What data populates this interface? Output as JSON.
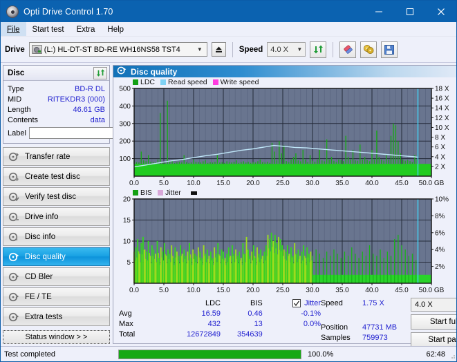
{
  "window": {
    "title": "Opti Drive Control 1.70",
    "icon": "disc-icon",
    "minimize": "minimize-icon",
    "maximize": "maximize-icon",
    "close": "close-icon"
  },
  "menubar": {
    "items": [
      {
        "label": "File",
        "active": true
      },
      {
        "label": "Start test",
        "active": false
      },
      {
        "label": "Extra",
        "active": false
      },
      {
        "label": "Help",
        "active": false
      }
    ]
  },
  "toolbar": {
    "drive_label": "Drive",
    "drive_value": "(L:)  HL-DT-ST BD-RE  WH16NS58 TST4",
    "eject_icon": "eject-icon",
    "speed_label": "Speed",
    "speed_value": "4.0 X",
    "refresh_icon": "refresh-icon",
    "eraser_icon": "eraser-icon",
    "discs_icon": "gold-discs-icon",
    "save_icon": "save-floppy-icon"
  },
  "disc_panel": {
    "title": "Disc",
    "refresh_icon": "refresh-icon",
    "rows": [
      {
        "key": "Type",
        "value": "BD-R DL"
      },
      {
        "key": "MID",
        "value": "RITEKDR3 (000)"
      },
      {
        "key": "Length",
        "value": "46.61 GB"
      },
      {
        "key": "Contents",
        "value": "data"
      }
    ],
    "label_key": "Label",
    "label_value": "",
    "label_placeholder": "",
    "label_button_icon": "disc-label-icon"
  },
  "sidebar": {
    "items": [
      {
        "label": "Transfer rate",
        "selected": false
      },
      {
        "label": "Create test disc",
        "selected": false
      },
      {
        "label": "Verify test disc",
        "selected": false
      },
      {
        "label": "Drive info",
        "selected": false
      },
      {
        "label": "Disc info",
        "selected": false
      },
      {
        "label": "Disc quality",
        "selected": true
      },
      {
        "label": "CD Bler",
        "selected": false
      },
      {
        "label": "FE / TE",
        "selected": false
      },
      {
        "label": "Extra tests",
        "selected": false
      }
    ],
    "status_window_label": "Status window > >"
  },
  "main": {
    "header_title": "Disc quality",
    "header_icon": "disc-quality-icon"
  },
  "chart_data": [
    {
      "type": "line",
      "name": "ldc-read-speed-chart",
      "title": "",
      "xlabel": "GB",
      "ylabel": "",
      "legend": [
        {
          "label": "LDC",
          "color": "#13a013"
        },
        {
          "label": "Read speed",
          "color": "#7fd2f4"
        },
        {
          "label": "Write speed",
          "color": "#ff3ce0"
        }
      ],
      "legend_position": "top-left",
      "grid": true,
      "x_ticks": [
        "0.0",
        "5.0",
        "10.0",
        "15.0",
        "20.0",
        "25.0",
        "30.0",
        "35.0",
        "40.0",
        "45.0",
        "50.0 GB"
      ],
      "xlim": [
        0,
        50
      ],
      "y_left_ticks": [
        "100",
        "200",
        "300",
        "400",
        "500"
      ],
      "ylim": [
        0,
        500
      ],
      "y_right_ticks": [
        "2 X",
        "4 X",
        "6 X",
        "8 X",
        "10 X",
        "12 X",
        "14 X",
        "16 X",
        "18 X"
      ],
      "ylim_right": [
        0,
        18
      ],
      "cursor_x": 47.73,
      "series": [
        {
          "name": "LDC",
          "color": "#13a013",
          "baseline": 70,
          "x": [
            0.0,
            0.4,
            0.8,
            1.2,
            1.6,
            2.0,
            2.4,
            2.8,
            3.2,
            3.6,
            4.0,
            4.4,
            4.8,
            5.2,
            5.6,
            6.0,
            6.4,
            6.8,
            7.2,
            7.6,
            8.0,
            8.4,
            8.8,
            9.2,
            9.6,
            10.0,
            10.4,
            10.8,
            11.2,
            11.6,
            12.0,
            12.4,
            12.8,
            13.2,
            13.6,
            14.0,
            14.4,
            14.8,
            15.2,
            15.6,
            16.0,
            16.4,
            16.8,
            17.2,
            17.6,
            18.0,
            18.4,
            18.8,
            19.2,
            19.6,
            20.0,
            20.4,
            20.8,
            21.2,
            21.6,
            22.0,
            22.4,
            22.8,
            23.2,
            23.6,
            24.0,
            24.4,
            24.8,
            25.2,
            25.6,
            26.0,
            26.4,
            26.8,
            27.2,
            27.6,
            28.0,
            28.4,
            28.8,
            29.2,
            29.6,
            30.0,
            30.4,
            30.8,
            31.2,
            31.6,
            32.0,
            32.4,
            32.8,
            33.2,
            33.6,
            34.0,
            34.4,
            34.8,
            35.2,
            35.6,
            36.0,
            36.4,
            36.8,
            37.2,
            37.6,
            38.0,
            38.4,
            38.8,
            39.2,
            39.6,
            40.0,
            40.4,
            40.8,
            41.2,
            41.6,
            42.0,
            42.4,
            42.8,
            43.2,
            43.6,
            44.0,
            44.4,
            44.8,
            45.2,
            45.6,
            46.0,
            46.4,
            46.8,
            47.2,
            47.6
          ],
          "values": [
            95,
            80,
            78,
            140,
            90,
            85,
            120,
            82,
            80,
            78,
            95,
            360,
            80,
            76,
            430,
            85,
            90,
            75,
            80,
            82,
            78,
            120,
            80,
            76,
            78,
            95,
            82,
            80,
            78,
            85,
            90,
            76,
            80,
            78,
            82,
            120,
            78,
            80,
            76,
            85,
            80,
            78,
            82,
            90,
            76,
            80,
            85,
            78,
            82,
            76,
            80,
            78,
            85,
            95,
            80,
            78,
            82,
            76,
            190,
            140,
            90,
            200,
            130,
            175,
            86,
            80,
            95,
            110,
            130,
            90,
            85,
            150,
            95,
            80,
            120,
            88,
            82,
            95,
            150,
            90,
            85,
            210,
            95,
            110,
            88,
            80,
            95,
            92,
            86,
            230,
            110,
            95,
            150,
            90,
            88,
            180,
            95,
            110,
            92,
            85,
            150,
            95,
            260,
            110,
            95,
            88,
            120,
            95,
            230,
            300,
            290,
            200,
            130,
            95,
            88,
            92,
            86,
            80,
            120,
            95
          ]
        },
        {
          "name": "Read speed",
          "color": "#a9dcf4",
          "x": [
            0.0,
            2.0,
            4.0,
            6.0,
            8.0,
            10.0,
            12.0,
            14.0,
            16.0,
            18.0,
            20.0,
            22.0,
            23.5,
            24.5,
            25.5,
            27.0,
            29.0,
            31.0,
            33.0,
            35.0,
            37.0,
            39.0,
            41.0,
            43.0,
            45.0,
            47.0,
            47.7
          ],
          "values": [
            1.9,
            2.3,
            2.7,
            3.1,
            3.4,
            3.8,
            4.2,
            4.5,
            4.9,
            5.3,
            5.6,
            6.0,
            6.3,
            6.2,
            6.1,
            5.9,
            5.8,
            5.6,
            5.4,
            5.2,
            5.0,
            4.8,
            4.6,
            4.4,
            4.2,
            4.0,
            3.9
          ]
        }
      ]
    },
    {
      "type": "bar",
      "name": "bis-jitter-chart",
      "title": "",
      "xlabel": "GB",
      "ylabel": "",
      "legend": [
        {
          "label": "BIS",
          "color": "#13a013"
        },
        {
          "label": "Jitter",
          "color": "#d9a8d9"
        }
      ],
      "legend_position": "top-left",
      "grid": true,
      "x_ticks": [
        "0.0",
        "5.0",
        "10.0",
        "15.0",
        "20.0",
        "25.0",
        "30.0",
        "35.0",
        "40.0",
        "45.0",
        "50.0 GB"
      ],
      "xlim": [
        0,
        50
      ],
      "y_left_ticks": [
        "5",
        "10",
        "15",
        "20"
      ],
      "ylim": [
        0,
        20
      ],
      "y_right_ticks": [
        "2%",
        "4%",
        "6%",
        "8%",
        "10%"
      ],
      "ylim_right": [
        0,
        10
      ],
      "cursor_x": 47.73,
      "series": [
        {
          "name": "BIS",
          "color": "#13a013",
          "baseline": 2.0,
          "x": [
            0.0,
            0.3,
            0.6,
            0.9,
            1.2,
            1.5,
            1.8,
            2.1,
            2.4,
            2.7,
            3.0,
            3.3,
            3.6,
            3.9,
            4.2,
            4.5,
            4.8,
            5.1,
            5.4,
            5.7,
            6.0,
            6.3,
            6.6,
            6.9,
            7.2,
            7.5,
            7.8,
            8.1,
            8.4,
            8.7,
            9.0,
            9.3,
            9.6,
            9.9,
            10.2,
            10.5,
            10.8,
            11.1,
            11.4,
            11.7,
            12.0,
            12.3,
            12.6,
            12.9,
            13.2,
            13.5,
            13.8,
            14.1,
            14.4,
            14.7,
            15.0,
            15.3,
            15.6,
            15.9,
            16.2,
            16.5,
            16.8,
            17.1,
            17.4,
            17.7,
            18.0,
            18.3,
            18.6,
            18.9,
            19.2,
            19.5,
            19.8,
            20.1,
            20.4,
            20.7,
            21.0,
            21.3,
            21.6,
            21.9,
            22.2,
            22.5,
            22.8,
            23.1,
            23.4,
            23.7,
            24.0,
            24.3,
            24.6,
            24.9,
            25.2,
            25.5,
            25.8,
            26.1,
            26.4,
            26.7,
            27.0,
            27.3,
            27.6,
            27.9,
            28.2,
            28.5,
            28.8,
            29.1,
            29.4,
            29.7,
            30.0,
            30.6,
            31.2,
            31.8,
            32.4,
            33.0,
            33.6,
            34.2,
            34.8,
            35.4,
            36.0,
            36.6,
            37.2,
            37.8,
            38.4,
            39.0,
            39.6,
            40.2,
            40.8,
            41.4,
            42.0,
            42.6,
            43.2,
            43.8,
            44.4,
            45.0,
            45.6,
            46.2,
            46.8,
            47.4
          ],
          "values": [
            7.5,
            8.5,
            10.5,
            7.0,
            9.5,
            11.0,
            8.0,
            7.5,
            10.0,
            6.5,
            9.0,
            8.0,
            7.0,
            10.0,
            6.0,
            8.5,
            7.5,
            9.5,
            6.5,
            8.0,
            7.0,
            9.0,
            6.0,
            8.5,
            7.5,
            6.5,
            9.0,
            7.0,
            8.0,
            6.5,
            7.5,
            9.5,
            6.0,
            8.0,
            7.0,
            6.5,
            8.5,
            7.5,
            6.0,
            9.0,
            7.0,
            8.0,
            6.5,
            7.5,
            6.0,
            8.5,
            7.0,
            9.5,
            6.5,
            8.0,
            7.5,
            6.0,
            7.0,
            8.5,
            6.5,
            9.0,
            7.0,
            8.0,
            6.5,
            7.5,
            6.0,
            9.5,
            7.0,
            11.0,
            8.0,
            6.5,
            7.5,
            9.0,
            6.0,
            8.5,
            7.0,
            8.0,
            6.5,
            7.5,
            9.0,
            11.5,
            10.5,
            12.0,
            10.0,
            11.5,
            9.5,
            11.0,
            10.5,
            9.0,
            8.0,
            7.5,
            9.0,
            7.0,
            8.5,
            6.5,
            9.5,
            7.0,
            8.0,
            6.5,
            7.5,
            9.0,
            6.0,
            8.5,
            7.0,
            7.5,
            6.5,
            8.0,
            7.0,
            6.0,
            7.5,
            6.5,
            8.0,
            7.0,
            6.0,
            7.5,
            6.5,
            8.5,
            7.0,
            6.0,
            7.5,
            6.5,
            9.0,
            7.0,
            6.5,
            8.0,
            6.0,
            7.5,
            6.5,
            10.5,
            11.5,
            9.0,
            8.0,
            6.5,
            7.0,
            5.5
          ]
        }
      ]
    }
  ],
  "stats": {
    "headers": {
      "ldc": "LDC",
      "bis": "BIS",
      "jitter": "Jitter"
    },
    "jitter_checked": true,
    "rows": [
      {
        "key": "Avg",
        "ldc": "16.59",
        "bis": "0.46",
        "jitter": "-0.1%"
      },
      {
        "key": "Max",
        "ldc": "432",
        "bis": "13",
        "jitter": "0.0%"
      },
      {
        "key": "Total",
        "ldc": "12672849",
        "bis": "354639",
        "jitter": ""
      }
    ]
  },
  "readout": {
    "rows": [
      {
        "key": "Speed",
        "value": "1.75 X"
      },
      {
        "key": "Position",
        "value": "47731 MB"
      },
      {
        "key": "Samples",
        "value": "759973"
      }
    ],
    "speed_select": "4.0 X",
    "start_full_label": "Start full",
    "start_part_label": "Start part"
  },
  "statusbar": {
    "message": "Test completed",
    "progress_percent": "100.0%",
    "progress_value": 100,
    "elapsed": "62:48",
    "progress_color": "#15a915"
  }
}
